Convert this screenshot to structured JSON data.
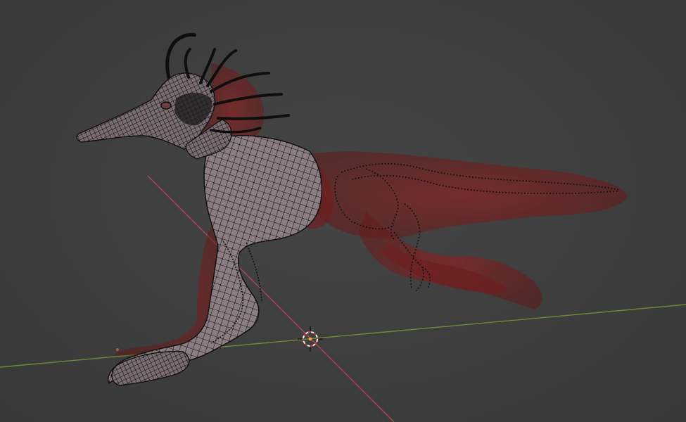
{
  "viewport": {
    "mode": "edit-mode-overlay",
    "colors": {
      "background": "#3d3d3d",
      "x_axis": "#b24a52",
      "y_axis": "#6e8f3a",
      "mesh_fill": "#8d7f84",
      "mesh_wire": "#161616",
      "overlay_red": "#8a1a1a",
      "cursor_ring": "#f2f2f2",
      "cursor_dot": "#f0a040"
    },
    "icons": {
      "cursor": "3d-cursor-icon"
    }
  }
}
